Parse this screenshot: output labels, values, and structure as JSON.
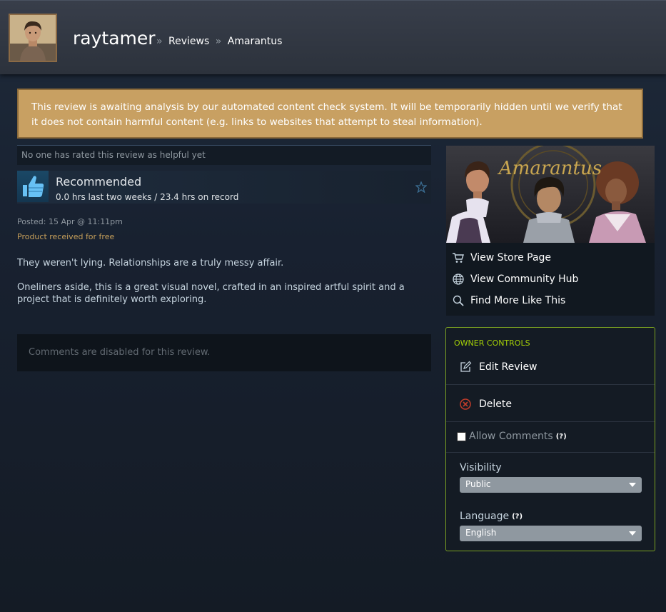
{
  "header": {
    "username": "raytamer",
    "breadcrumb": [
      {
        "label": "Reviews"
      },
      {
        "label": "Amarantus"
      }
    ],
    "separator": "»"
  },
  "notice": {
    "text": "This review is awaiting analysis by our automated content check system. It will be temporarily hidden until we verify that it does not contain harmful content (e.g. links to websites that attempt to steal information)."
  },
  "review": {
    "helpful_text": "No one has rated this review as helpful yet",
    "recommendation": "Recommended",
    "hours": "0.0 hrs last two weeks / 23.4 hrs on record",
    "posted": "Posted: 15 Apr @ 11:11pm",
    "received": "Product received for free",
    "paragraphs": [
      "They weren't lying. Relationships are a truly messy affair.",
      "Oneliners aside, this is a great visual novel, crafted in an inspired artful spirit and a project that is definitely worth exploring."
    ],
    "comments_disabled": "Comments are disabled for this review."
  },
  "game": {
    "name": "Amarantus",
    "links": {
      "store": "View Store Page",
      "hub": "View Community Hub",
      "more": "Find More Like This"
    }
  },
  "owner_controls": {
    "title": "OWNER CONTROLS",
    "edit": "Edit Review",
    "delete": "Delete",
    "allow_comments": "Allow Comments",
    "allow_comments_checked": false,
    "help": "(?)",
    "visibility_label": "Visibility",
    "visibility_value": "Public",
    "language_label": "Language",
    "language_value": "English"
  },
  "colors": {
    "notice_bg": "#c8a062",
    "owner_border": "#7aa022",
    "owner_title": "#a4d007",
    "received": "#c7a05a"
  }
}
